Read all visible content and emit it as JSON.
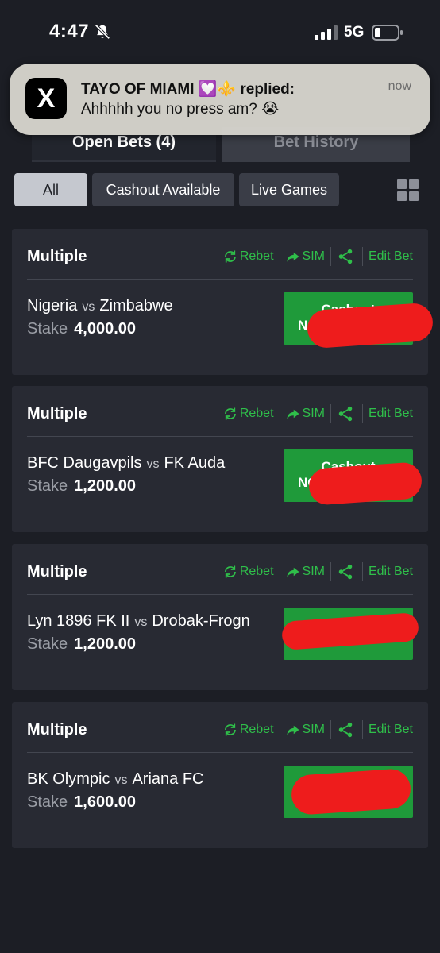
{
  "status_bar": {
    "time": "4:47",
    "network": "5G"
  },
  "notification": {
    "app_icon": "x-logo-icon",
    "app_glyph": "X",
    "title": "TAYO OF MIAMI 💟⚜️ replied:",
    "body": "Ahhhhh you no press am? 😭",
    "time": "now"
  },
  "tabs": {
    "open_bets": "Open Bets (4)",
    "bet_history": "Bet History"
  },
  "filters": {
    "all": "All",
    "cashout": "Cashout Available",
    "live": "Live Games"
  },
  "colors": {
    "accent_green": "#2fbf4a",
    "cashout_green": "#1f9a3a",
    "redaction": "#ee1c1c"
  },
  "actions": {
    "rebet": "Rebet",
    "sim": "SIM",
    "edit": "Edit Bet"
  },
  "bets": [
    {
      "type": "Multiple",
      "home": "Nigeria",
      "vs": "vs",
      "away": "Zimbabwe",
      "stake_label": "Stake",
      "stake": "4,000.00",
      "cashout_line1": "Cashout",
      "cashout_line2": "NG"
    },
    {
      "type": "Multiple",
      "home": "BFC Daugavpils",
      "vs": "vs",
      "away": "FK Auda",
      "stake_label": "Stake",
      "stake": "1,200.00",
      "cashout_line1": "Cashout",
      "cashout_line2": "NG"
    },
    {
      "type": "Multiple",
      "home": "Lyn 1896 FK II",
      "vs": "vs",
      "away": "Drobak-Frogn",
      "stake_label": "Stake",
      "stake": "1,200.00",
      "cashout_line1": "",
      "cashout_line2": ""
    },
    {
      "type": "Multiple",
      "home": "BK Olympic",
      "vs": "vs",
      "away": "Ariana FC",
      "stake_label": "Stake",
      "stake": "1,600.00",
      "cashout_line1": "",
      "cashout_line2": ""
    }
  ]
}
